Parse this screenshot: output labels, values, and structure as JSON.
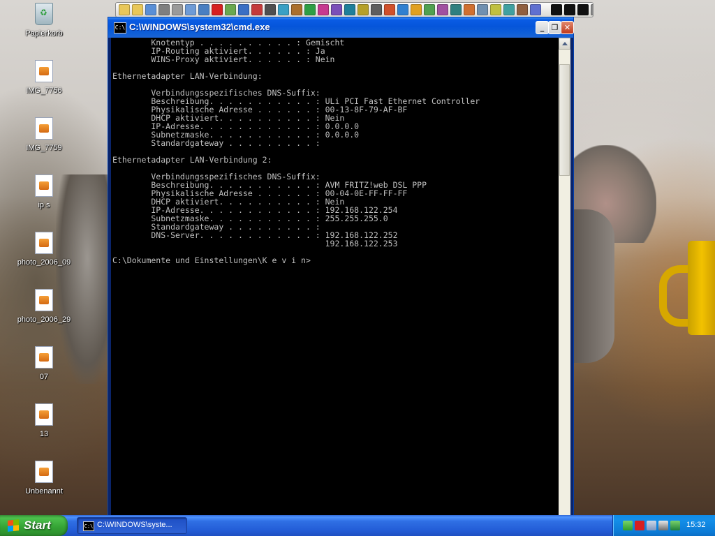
{
  "desktop": {
    "icons": [
      {
        "label": "Papierkorb",
        "kind": "recycle-bin"
      },
      {
        "label": "IMG_7756",
        "kind": "image-file"
      },
      {
        "label": "IMG_7759",
        "kind": "image-file"
      },
      {
        "label": "ip s",
        "kind": "image-file"
      },
      {
        "label": "photo_2006_09",
        "kind": "image-file"
      },
      {
        "label": "photo_2006_29",
        "kind": "image-file"
      },
      {
        "label": "07",
        "kind": "image-file"
      },
      {
        "label": "13",
        "kind": "image-file"
      },
      {
        "label": "Unbenannt",
        "kind": "image-file"
      }
    ]
  },
  "quick_launch": {
    "icons": [
      "folder-icon",
      "folder-icon",
      "explorer-icon",
      "mail-icon",
      "notepad-icon",
      "paint-icon",
      "media-icon",
      "ati-icon",
      "app-icon",
      "app-icon",
      "app-icon",
      "app-icon",
      "app-icon",
      "app-icon",
      "info-icon",
      "app-icon",
      "app-icon",
      "app-icon",
      "app-icon",
      "app-icon",
      "app-icon",
      "app-icon",
      "app-icon",
      "app-icon",
      "app-icon",
      "app-icon",
      "app-icon",
      "app-icon",
      "app-icon",
      "app-icon",
      "app-icon",
      "app-icon"
    ],
    "colors": [
      "#e8c75a",
      "#e8c75a",
      "#5a8fd6",
      "#7f7f7f",
      "#9a9a9a",
      "#6e9bd6",
      "#4a7fc1",
      "#d62020",
      "#6aa84f",
      "#3a6fc4",
      "#c43a3a",
      "#4f4f4f",
      "#3aa0c4",
      "#aa6f2c",
      "#2e9e44",
      "#c63a8f",
      "#7a4fb8",
      "#1e7f9a",
      "#b5a02a",
      "#5e5e5e",
      "#d0502a",
      "#3080d0",
      "#e0a020",
      "#50a050",
      "#a050a0",
      "#2f7f7f",
      "#d07030",
      "#7090b0",
      "#c0c040",
      "#40a0a0",
      "#906040",
      "#6070d0"
    ],
    "extra_icons": [
      "wave-icon",
      "wave-icon",
      "wave-icon",
      "app-icon",
      "app-icon",
      "app-icon",
      "app-icon"
    ]
  },
  "window": {
    "title": "C:\\WINDOWS\\system32\\cmd.exe",
    "icon_text": "C:\\",
    "minimize_glyph": "_",
    "maximize_glyph": "❐",
    "close_glyph": "✕"
  },
  "console": {
    "lines": [
      "        Knotentyp . . . . . . . . . . : Gemischt",
      "        IP-Routing aktiviert. . . . . . : Ja",
      "        WINS-Proxy aktiviert. . . . . . : Nein",
      "",
      "Ethernetadapter LAN-Verbindung:",
      "",
      "        Verbindungsspezifisches DNS-Suffix:",
      "        Beschreibung. . . . . . . . . . . : ULi PCI Fast Ethernet Controller",
      "        Physikalische Adresse . . . . . . : 00-13-8F-79-AF-BF",
      "        DHCP aktiviert. . . . . . . . . . : Nein",
      "        IP-Adresse. . . . . . . . . . . . : 0.0.0.0",
      "        Subnetzmaske. . . . . . . . . . . : 0.0.0.0",
      "        Standardgateway . . . . . . . . . :",
      "",
      "Ethernetadapter LAN-Verbindung 2:",
      "",
      "        Verbindungsspezifisches DNS-Suffix:",
      "        Beschreibung. . . . . . . . . . . : AVM FRITZ!web DSL PPP",
      "        Physikalische Adresse . . . . . . : 00-04-0E-FF-FF-FF",
      "        DHCP aktiviert. . . . . . . . . . : Nein",
      "        IP-Adresse. . . . . . . . . . . . : 192.168.122.254",
      "        Subnetzmaske. . . . . . . . . . . : 255.255.255.0",
      "        Standardgateway . . . . . . . . . :",
      "        DNS-Server. . . . . . . . . . . . : 192.168.122.252",
      "                                            192.168.122.253",
      "",
      "C:\\Dokumente und Einstellungen\\K e v i n>"
    ],
    "text_color": "#c0c0c0",
    "background": "#000000"
  },
  "taskbar": {
    "start_label": "Start",
    "tasks": [
      {
        "label": "C:\\WINDOWS\\syste...",
        "icon_text": "C:\\"
      }
    ],
    "tray": {
      "icons": [
        "battery-icon",
        "ati-icon",
        "network-icon",
        "monitor-icon",
        "app-icon"
      ],
      "clock": "15:32"
    }
  }
}
